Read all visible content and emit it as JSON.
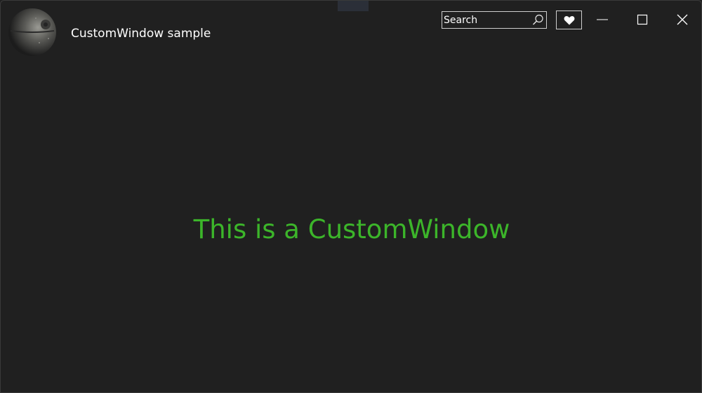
{
  "window": {
    "title": "CustomWindow sample",
    "app_icon": "death-star-icon"
  },
  "titlebar": {
    "search": {
      "placeholder": "Search",
      "value": "",
      "icon": "search-icon"
    },
    "heart_button": {
      "icon": "heart-icon"
    },
    "caption_buttons": {
      "minimize_icon": "minimize-icon",
      "maximize_icon": "maximize-icon",
      "close_icon": "close-icon"
    }
  },
  "content": {
    "message": "This is a CustomWindow"
  },
  "colors": {
    "background": "#202020",
    "title_text": "#ffffff",
    "accent_text": "#3cb52a",
    "control_border": "#cfcfcf"
  }
}
